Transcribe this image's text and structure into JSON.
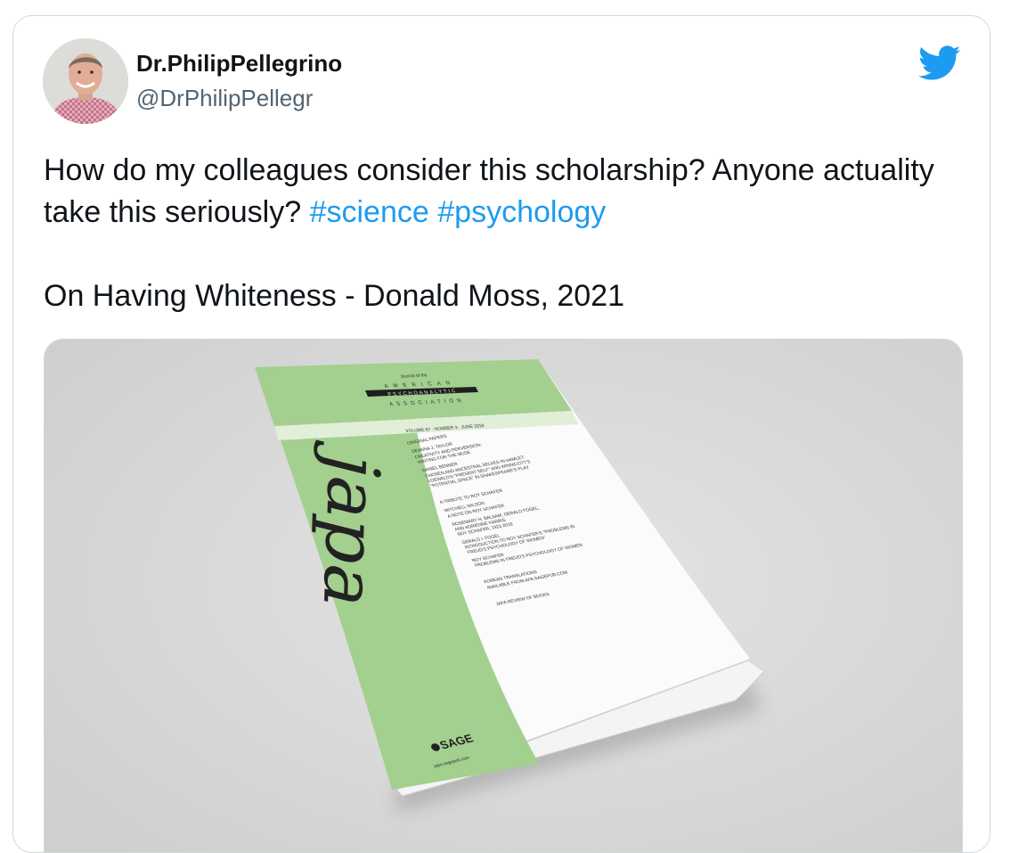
{
  "tweet": {
    "display_name": "Dr.PhilipPellegrino",
    "handle": "@DrPhilipPellegr",
    "text_main": "How do my colleagues consider this scholarship? Anyone actuality take this seriously? ",
    "hashtags": [
      "#science",
      "#psychology"
    ],
    "text_second": "On Having Whiteness - Donald Moss, 2021",
    "brand_color": "#1d9bf0"
  },
  "journal": {
    "association_of": "Journal of the",
    "association_line1": "AMERICAN",
    "association_line2": "PSYCHOANALYTIC",
    "association_line3": "ASSOCIATION",
    "issue": "VOLUME 67 · NUMBER 3 · JUNE 2019",
    "title": "japa",
    "publisher": "SAGE",
    "url": "japa.sagepub.com",
    "toc": [
      "ORIGINAL PAPERS",
      "DEANNA J. TAYLOR",
      "CREATIVITY AND PERVERSION:",
      "WAITING FOR THE MUSE",
      "DANIEL BENNER",
      "CHOSEN AND ANCESTRAL SELVES IN HAMLET:",
      "LOEWALD'S \"PRESENT SELF\" AND WINNICOTT'S",
      "\"POTENTIAL SPACE\" IN SHAKESPEARE'S PLAY",
      "",
      "A TRIBUTE TO ROY SCHAFER",
      "MITCHELL WILSON",
      "A NOTE ON ROY SCHAFER",
      "ROSEMARY H. BALSAM, GERALD FOGEL,",
      "AND ADRIENNE HARRIS",
      "ROY SCHAFER, 1922-2018",
      "GERALD I. FOGEL",
      "INTRODUCTION TO ROY SCHAFER'S \"PROBLEMS IN",
      "FREUD'S PSYCHOLOGY OF WOMEN\"",
      "ROY SCHAFER",
      "PROBLEMS IN FREUD'S PSYCHOLOGY OF WOMEN",
      "",
      "KOREAN TRANSLATIONS",
      "AVAILABLE FROM APA.SAGEPUB.COM",
      "",
      "JAPA REVIEW OF BOOKS"
    ],
    "cover_green": "#a3cf8f",
    "stripe_green": "#e1eed8"
  }
}
